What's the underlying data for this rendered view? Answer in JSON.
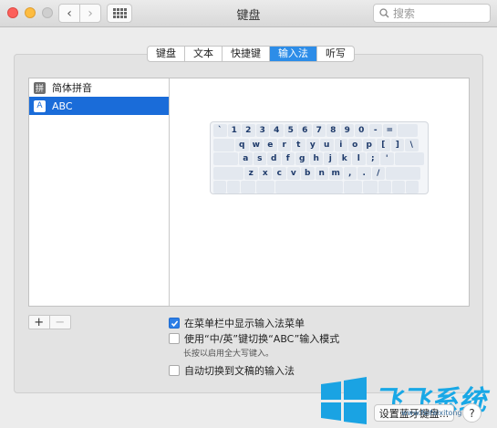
{
  "window": {
    "title": "键盘",
    "search_placeholder": "搜索"
  },
  "toolbar": {
    "back_glyph": "‹",
    "forward_glyph": "›"
  },
  "tabs": [
    {
      "label": "键盘",
      "active": false
    },
    {
      "label": "文本",
      "active": false
    },
    {
      "label": "快捷键",
      "active": false
    },
    {
      "label": "输入法",
      "active": true
    },
    {
      "label": "听写",
      "active": false
    }
  ],
  "sources": [
    {
      "label": "简体拼音",
      "icon_text": "拼",
      "icon": "pinyin-icon",
      "selected": false
    },
    {
      "label": "ABC",
      "icon_text": "A",
      "icon": "abc-icon",
      "selected": true
    }
  ],
  "keyboard": {
    "rows": [
      [
        "`",
        "1",
        "2",
        "3",
        "4",
        "5",
        "6",
        "7",
        "8",
        "9",
        "0",
        "-",
        "="
      ],
      [
        "q",
        "w",
        "e",
        "r",
        "t",
        "y",
        "u",
        "i",
        "o",
        "p",
        "[",
        "]",
        "\\"
      ],
      [
        "a",
        "s",
        "d",
        "f",
        "g",
        "h",
        "j",
        "k",
        "l",
        ";",
        "'"
      ],
      [
        "z",
        "x",
        "c",
        "v",
        "b",
        "n",
        "m",
        ",",
        ".",
        "/"
      ]
    ]
  },
  "list_controls": {
    "add": "+",
    "remove": "−"
  },
  "options": {
    "show_menu": {
      "label": "在菜单栏中显示输入法菜单",
      "checked": true
    },
    "zh_en_switch": {
      "label": "使用“中/英”键切换“ABC”输入模式",
      "checked": false
    },
    "zh_en_hint": "长按以启用全大写键入。",
    "auto_switch": {
      "label": "自动切换到文稿的输入法",
      "checked": false
    }
  },
  "footer": {
    "bluetooth_button": "设置蓝牙键盘...",
    "help": "?"
  },
  "watermark": {
    "title": "飞飞系统",
    "url": "www.feifeixitong.com"
  },
  "colors": {
    "accent": "#2d8de8",
    "selection": "#1a6cd9",
    "close": "#fc605b",
    "minimize": "#fdbc40",
    "watermark": "#19a8e6"
  }
}
